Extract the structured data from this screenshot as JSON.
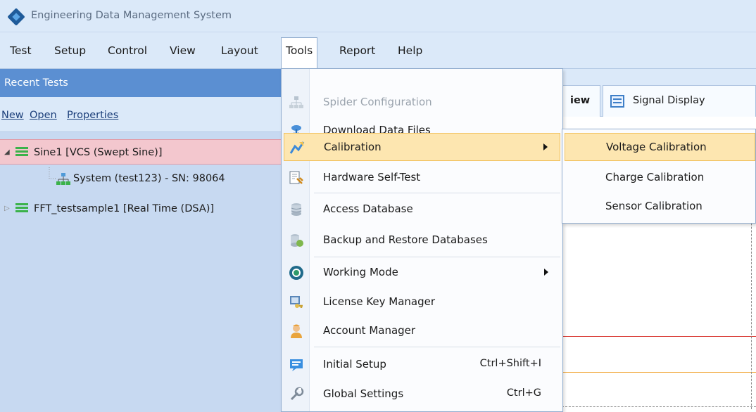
{
  "window": {
    "title": "Engineering Data Management System"
  },
  "menubar": {
    "items": [
      {
        "label": "Test"
      },
      {
        "label": "Setup"
      },
      {
        "label": "Control"
      },
      {
        "label": "View"
      },
      {
        "label": "Layout"
      },
      {
        "label": "Tools"
      },
      {
        "label": "Report"
      },
      {
        "label": "Help"
      }
    ]
  },
  "left_panel": {
    "header": "Recent Tests",
    "toolbar": {
      "new": "New",
      "open": "Open",
      "properties": "Properties"
    },
    "tree": [
      {
        "label": "Sine1   [VCS (Swept Sine)]",
        "expander": "◢"
      },
      {
        "label": "System (test123) - SN: 98064"
      },
      {
        "label": "FFT_testsample1   [Real Time (DSA)]",
        "expander": "▷"
      }
    ]
  },
  "tabs": [
    {
      "label": "iew"
    },
    {
      "label": "Signal Display"
    }
  ],
  "tools_menu": {
    "items": [
      {
        "label": "Spider Configuration",
        "icon": "network-icon",
        "disabled": true
      },
      {
        "label": "Download Data Files",
        "icon": "download-icon"
      },
      {
        "label": "Calibration",
        "icon": "calibration-icon",
        "submenu": true,
        "highlight": true
      },
      {
        "label": "Hardware Self-Test",
        "icon": "self-test-icon"
      },
      {
        "label": "Access Database",
        "icon": "database-icon"
      },
      {
        "label": "Backup and Restore Databases",
        "icon": "backup-icon"
      },
      {
        "label": "Working Mode",
        "icon": "mode-icon",
        "submenu": true
      },
      {
        "label": "License Key Manager",
        "icon": "license-key-icon"
      },
      {
        "label": "Account Manager",
        "icon": "account-icon"
      },
      {
        "label": "Initial Setup",
        "shortcut": "Ctrl+Shift+I",
        "icon": "setup-icon"
      },
      {
        "label": "Global Settings",
        "shortcut": "Ctrl+G",
        "icon": "settings-icon"
      }
    ]
  },
  "calibration_submenu": {
    "items": [
      {
        "label": "Voltage Calibration"
      },
      {
        "label": "Charge Calibration"
      },
      {
        "label": "Sensor Calibration"
      }
    ]
  },
  "colors": {
    "menubar_bg": "#dbe9f9",
    "panel_header": "#5b8fd2",
    "tree_bg": "#c7d9f1",
    "selected_row": "#f3c7ce",
    "menu_highlight": "#fde6b0",
    "plot_red": "#d8322b",
    "plot_orange": "#f0a12b"
  }
}
